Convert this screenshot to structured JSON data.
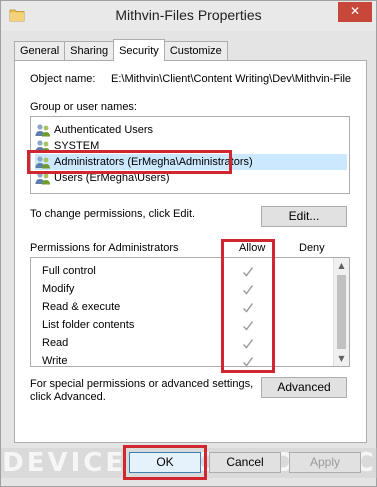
{
  "window": {
    "title": "Mithvin-Files Properties",
    "close_glyph": "✕"
  },
  "tabs": [
    {
      "label": "General"
    },
    {
      "label": "Sharing"
    },
    {
      "label": "Security"
    },
    {
      "label": "Customize"
    }
  ],
  "object": {
    "label": "Object name:",
    "value": "E:\\Mithvin\\Client\\Content Writing\\Dev\\Mithvin-Files"
  },
  "group": {
    "label": "Group or user names:",
    "items": [
      {
        "name": "Authenticated Users"
      },
      {
        "name": "SYSTEM"
      },
      {
        "name": "Administrators (ErMegha\\Administrators)"
      },
      {
        "name": "Users (ErMegha\\Users)"
      }
    ]
  },
  "edit": {
    "hint": "To change permissions, click Edit.",
    "button": "Edit..."
  },
  "permissions": {
    "label": "Permissions for Administrators",
    "allow_header": "Allow",
    "deny_header": "Deny",
    "rows": [
      {
        "name": "Full control"
      },
      {
        "name": "Modify"
      },
      {
        "name": "Read & execute"
      },
      {
        "name": "List folder contents"
      },
      {
        "name": "Read"
      },
      {
        "name": "Write"
      }
    ]
  },
  "advanced": {
    "hint_line1": "For special permissions or advanced settings,",
    "hint_line2": "click Advanced.",
    "button": "Advanced"
  },
  "footer": {
    "ok": "OK",
    "cancel": "Cancel",
    "apply": "Apply"
  },
  "watermark": {
    "text": "DEVICE TRICKS DEVIC"
  },
  "colors": {
    "highlight": "#d0262f",
    "selected": "#cce8ff",
    "close": "#c7483b"
  }
}
